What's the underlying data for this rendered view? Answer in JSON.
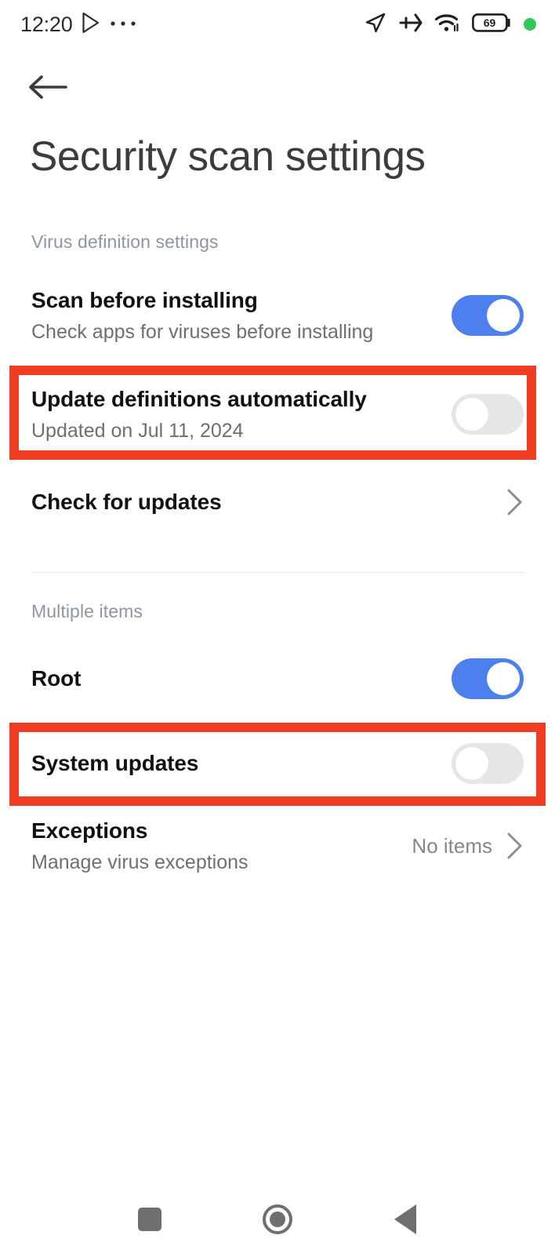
{
  "status_bar": {
    "clock": "12:20",
    "left_icons": [
      "play-store-icon",
      "more-horizontal-icon"
    ],
    "right_icons": [
      "location-arrow-icon",
      "airplane-mode-icon",
      "wifi-icon",
      "battery-icon",
      "recording-indicator-dot"
    ],
    "battery_level": "69",
    "indicator_color": "#34c759"
  },
  "nav": {
    "back_icon": "arrow-left-icon"
  },
  "header": {
    "title": "Security scan settings"
  },
  "sections": [
    {
      "header": "Virus definition settings",
      "rows": [
        {
          "title": "Scan before installing",
          "subtitle": "Check apps for viruses before installing",
          "control": "toggle",
          "toggle_state": "on"
        },
        {
          "title": "Update definitions automatically",
          "subtitle": "Updated on Jul 11, 2024",
          "control": "toggle",
          "toggle_state": "off",
          "highlighted": true
        },
        {
          "title": "Check for updates",
          "subtitle": "",
          "control": "chevron"
        }
      ]
    },
    {
      "header": "Multiple items",
      "rows": [
        {
          "title": "Root",
          "subtitle": "",
          "control": "toggle",
          "toggle_state": "on"
        },
        {
          "title": "System updates",
          "subtitle": "",
          "control": "toggle",
          "toggle_state": "off",
          "highlighted": true
        },
        {
          "title": "Exceptions",
          "subtitle": "Manage virus exceptions",
          "control": "chevron",
          "value": "No items"
        }
      ]
    }
  ],
  "annotations": {
    "color": "#ef3c23",
    "boxes": [
      "update-definitions-automatically-row",
      "system-updates-row"
    ]
  },
  "system_nav": {
    "recents_label": "recents-square-icon",
    "home_label": "home-circle-icon",
    "back_label": "back-triangle-icon"
  },
  "colors": {
    "toggle_on": "#4d7fee",
    "toggle_off": "#e4e6e8",
    "section_header": "#8f95a3",
    "title": "#3c3c3c"
  }
}
